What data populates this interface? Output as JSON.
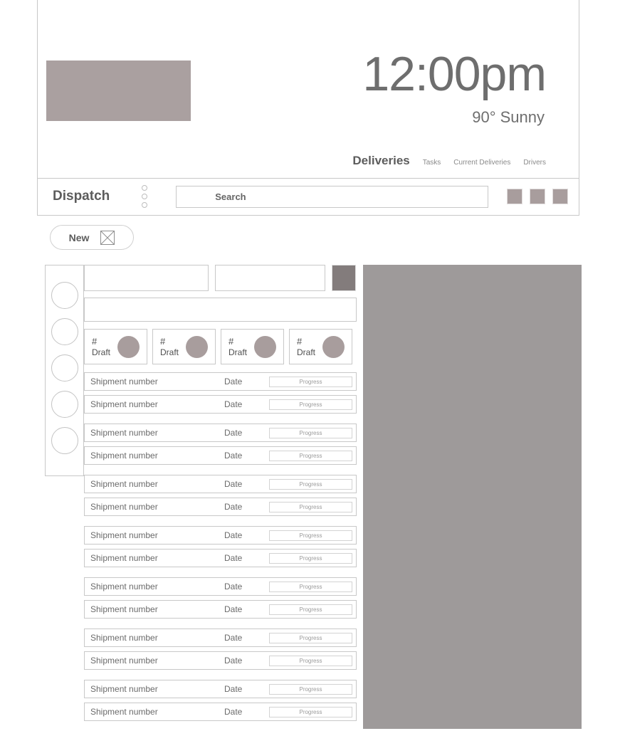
{
  "header": {
    "logo_alt": "logo-placeholder",
    "time": "12:00pm",
    "weather": "90° Sunny",
    "nav": {
      "active": "Deliveries",
      "items": [
        "Tasks",
        "Current Deliveries",
        "Drivers"
      ]
    }
  },
  "toolbar": {
    "app_title": "Dispatch",
    "kebab_icon": "three-dot-vertical-menu-icon",
    "search_label": "Search",
    "search_placeholder": "Search",
    "icon_buttons": [
      "icon-button-1",
      "icon-button-2",
      "icon-button-3"
    ]
  },
  "actions": {
    "new_label": "New",
    "new_icon": "crossed-box-placeholder-icon"
  },
  "rail": {
    "avatars": [
      "avatar-1",
      "avatar-2",
      "avatar-3",
      "avatar-4",
      "avatar-5"
    ]
  },
  "form": {
    "input_a_value": "",
    "input_b_value": "",
    "input_wide_value": "",
    "square_button_icon": "filled-square-button-icon"
  },
  "stats": [
    {
      "count": "#",
      "label": "Draft"
    },
    {
      "count": "#",
      "label": "Draft"
    },
    {
      "count": "#",
      "label": "Draft"
    },
    {
      "count": "#",
      "label": "Draft"
    }
  ],
  "list": {
    "row": {
      "shipment_label": "Shipment number",
      "date_label": "Date",
      "progress_label": "Progress"
    },
    "groups": [
      {
        "rows": 2
      },
      {
        "rows": 2
      },
      {
        "rows": 2
      },
      {
        "rows": 2
      },
      {
        "rows": 2
      },
      {
        "rows": 2
      },
      {
        "rows": 2
      }
    ]
  },
  "right_panel": {
    "name": "preview-panel-placeholder"
  },
  "colors": {
    "logo_block": "#aaa0a0",
    "right_panel": "#9e9a9a",
    "accent_square": "#837c7c",
    "icon_square": "#a89d9d",
    "border": "#c8c8c8",
    "text": "#6e6e6e"
  }
}
